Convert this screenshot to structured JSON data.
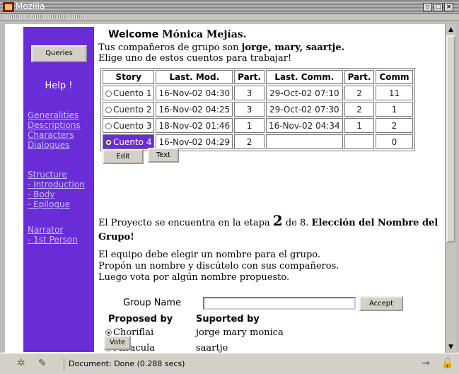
{
  "window": {
    "title": "Mozilla",
    "controls": [
      "▫",
      "□",
      "×"
    ]
  },
  "sidebar": {
    "queries_label": "Queries",
    "help_label": "Help !",
    "group1": [
      "Generalities",
      "Descriptions",
      "Characters",
      "Dialogues"
    ],
    "group2": [
      "Structure",
      "- Introduction",
      "- Body",
      "- Epilogue"
    ],
    "group3": [
      "Narrator",
      "- 1st Person"
    ]
  },
  "welcome": {
    "prefix": "Welcome",
    "name": "Mónica Mejías."
  },
  "intro": {
    "partners_prefix": "Tus compañeros de grupo son ",
    "partners": "jorge, mary, saartje.",
    "choose": "Elige uno de estos cuentos para trabajar!"
  },
  "stories_table": {
    "headers": [
      "Story",
      "Last. Mod.",
      "Part.",
      "Last. Comm.",
      "Part.",
      "Comm"
    ],
    "rows": [
      {
        "story": "Cuento 1",
        "last_mod": "16-Nov-02 04:30",
        "part": "3",
        "last_comm": "29-Oct-02 07:10",
        "part2": "2",
        "comm": "11",
        "selected": false
      },
      {
        "story": "Cuento 2",
        "last_mod": "16-Nov-02 04:25",
        "part": "3",
        "last_comm": "29-Oct-02 07:30",
        "part2": "2",
        "comm": "1",
        "selected": false
      },
      {
        "story": "Cuento 3",
        "last_mod": "18-Nov-02 01:46",
        "part": "1",
        "last_comm": "16-Nov-02 04:34",
        "part2": "1",
        "comm": "2",
        "selected": false
      },
      {
        "story": "Cuento 4",
        "last_mod": "16-Nov-02 04:29",
        "part": "2",
        "last_comm": "",
        "part2": "",
        "comm": "0",
        "selected": true
      }
    ]
  },
  "buttons": {
    "edit": "Edit",
    "text": "Text",
    "accept": "Accept",
    "vote": "Vote"
  },
  "stage": {
    "prefix": "El Proyecto se encuentra en la etapa ",
    "number": "2",
    "of": " de 8. ",
    "title": "Elección del Nombre del Grupo!"
  },
  "instructions": [
    "El equipo debe elegir un nombre para el grupo.",
    "Propón un nombre y discútelo con sus compañeros.",
    "Luego vota por algún nombre propuesto."
  ],
  "group_name": {
    "label": "Group Name",
    "value": ""
  },
  "proposals": {
    "proposed_by_header": "Proposed by",
    "supported_by_header": "Suported by",
    "items": [
      {
        "name": "Choriflai",
        "supported_by": "jorge mary monica",
        "checked": true
      },
      {
        "name": "Miracula",
        "supported_by": "saartje",
        "checked": false
      }
    ]
  },
  "statusbar": {
    "text": "Document: Done (0.288 secs)"
  }
}
